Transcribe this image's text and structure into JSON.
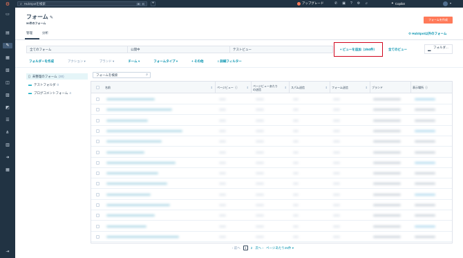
{
  "topnav": {
    "search_text": "HubSpotを検索",
    "shortcut_keys": [
      "⌘",
      "K"
    ],
    "upgrade_label": "アップグレード",
    "copilot_label": "Copilot"
  },
  "header": {
    "title": "フォーム",
    "subtitle": "50件のフォーム",
    "create_button": "フォームを作成",
    "tabs": [
      "管理",
      "分析"
    ],
    "hubspot_link": "HubSpot以外のフォーム"
  },
  "views": {
    "tabs": [
      "全てのフォーム",
      "公開中",
      "テストビュー"
    ],
    "add_view_label": "+ ビューを追加（3/50件）",
    "all_views_label": "全てのビュー",
    "folder_label": "フォルダ..."
  },
  "filters": {
    "create_folder": "フォルダーを作成",
    "action": "アクション",
    "brand": "ブランド",
    "team": "チーム",
    "form_type": "フォームタイプ",
    "other": "+ その他",
    "advanced": "詳細フィルター"
  },
  "folders": [
    {
      "label": "未整理のフォーム",
      "count": "(30)"
    },
    {
      "label": "テストフォルダ",
      "count": "0"
    },
    {
      "label": "ブログコメントフォーム",
      "count": "4"
    }
  ],
  "form_search": {
    "placeholder": "フォームを検索"
  },
  "table": {
    "columns": [
      "名前",
      "ページビュー",
      "ページビューあたりの送信",
      "スパム送信",
      "フォーム送信",
      "ブランド",
      "表示場所"
    ]
  },
  "pager": {
    "prev": "前へ",
    "page1": "1",
    "page2": "2",
    "next": "次へ",
    "per_page": "ページあたり25件"
  }
}
